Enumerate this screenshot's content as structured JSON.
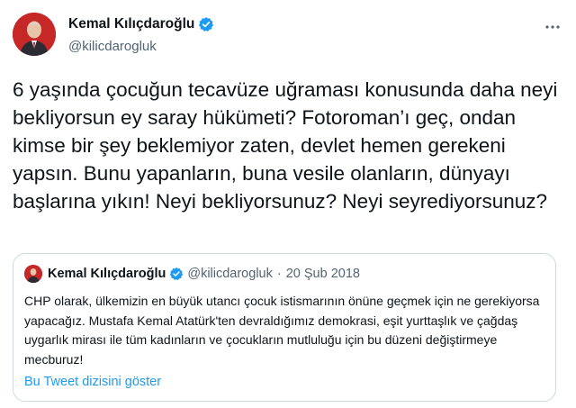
{
  "author": {
    "name": "Kemal Kılıçdaroğlu",
    "handle": "@kilicdarogluk"
  },
  "tweet": {
    "text": "6 yaşında çocuğun tecavüze uğraması konusunda daha neyi bekliyorsun ey saray hükümeti? Fotoroman’ı geç, ondan kimse bir şey beklemiyor zaten, devlet hemen gerekeni yapsın. Bunu yapanların, buna vesile olanların, dünyayı başlarına yıkın! Neyi bekliyorsunuz? Neyi seyrediyorsunuz?"
  },
  "quoted": {
    "name": "Kemal Kılıçdaroğlu",
    "handle": "@kilicdarogluk",
    "separator": "·",
    "date": "20 Şub 2018",
    "text": "CHP olarak, ülkemizin en büyük utancı çocuk istismarının önüne geçmek için ne gerekiyorsa yapacağız. Mustafa Kemal Atatürk'ten devraldığımız demokrasi, eşit yurttaşlık ve çağdaş uygarlık mirası ile tüm kadınların ve çocukların mutluluğu için bu düzeni değiştirmeye mecburuz!",
    "thread_link": "Bu Tweet dizisini göster"
  },
  "icons": {
    "verified": "verified-badge-icon",
    "more": "more-options-icon"
  },
  "colors": {
    "accent": "#1d9bf0",
    "text": "#0f1419",
    "secondary": "#536471",
    "border": "#cfd9de"
  }
}
